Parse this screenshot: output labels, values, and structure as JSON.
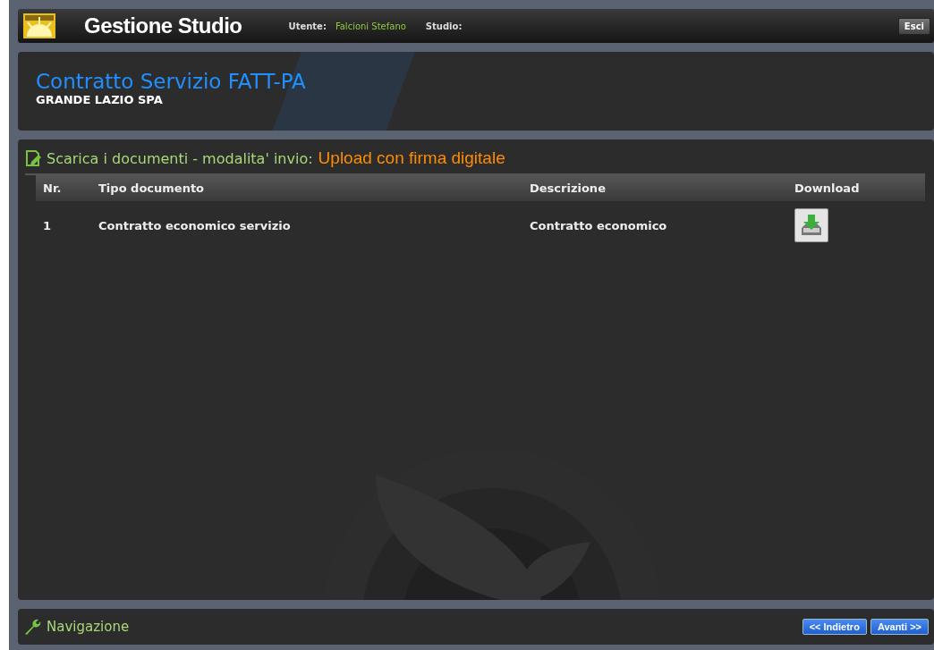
{
  "header": {
    "title": "Gestione Studio",
    "user_label": "Utente:",
    "user_name": "Falcioni Stefano",
    "studio_label": "Studio:",
    "logout": "Esci"
  },
  "banner": {
    "title": "Contratto Servizio FATT-PA",
    "subtitle": "GRANDE LAZIO SPA"
  },
  "documents": {
    "heading": "Scarica i documenti - modalita' invio:",
    "mode": "Upload con firma digitale",
    "columns": [
      "Nr.",
      "Tipo documento",
      "Descrizione",
      "Download"
    ],
    "rows": [
      {
        "nr": "1",
        "type": "Contratto economico servizio",
        "description": "Contratto economico"
      }
    ]
  },
  "navigation": {
    "title": "Navigazione",
    "buttons": [
      "<< Indietro",
      "Avanti >>"
    ]
  }
}
